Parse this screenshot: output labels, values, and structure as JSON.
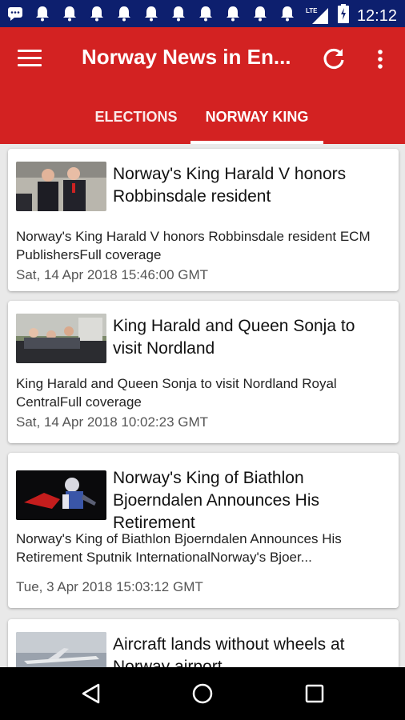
{
  "status_bar": {
    "time": "12:12",
    "network": "LTE",
    "icons_left": [
      "message-icon",
      "notification-bell-icon",
      "notification-bell-icon",
      "notification-bell-icon",
      "notification-bell-icon",
      "notification-bell-icon",
      "notification-bell-icon",
      "notification-bell-icon",
      "notification-bell-icon",
      "notification-bell-icon",
      "notification-bell-icon"
    ]
  },
  "app_bar": {
    "title": "Norway News in En...",
    "color": "#d32222",
    "tabs": [
      {
        "label": "ELECTIONS",
        "selected": false
      },
      {
        "label": "NORWAY KING",
        "selected": true
      }
    ]
  },
  "articles": [
    {
      "headline": "Norway's King Harald V honors Robbinsdale resident",
      "summary": "Norway's King Harald V honors Robbinsdale resident ECM PublishersFull coverage",
      "date": "Sat, 14 Apr 2018 15:46:00 GMT"
    },
    {
      "headline": "King Harald and Queen Sonja to visit Nordland",
      "summary": "King Harald and Queen Sonja to visit Nordland  Royal CentralFull coverage",
      "date": "Sat, 14 Apr 2018 10:02:23 GMT"
    },
    {
      "headline": "Norway's King of Biathlon Bjoerndalen Announces His Retirement",
      "summary": "Norway's King of Biathlon Bjoerndalen Announces His Retirement  Sputnik InternationalNorway's Bjoer...",
      "date": "Tue, 3 Apr 2018 15:03:12 GMT"
    },
    {
      "headline": "Aircraft lands without wheels at Norway airport",
      "summary": "",
      "date": ""
    }
  ],
  "nav_bar": {
    "buttons": [
      "back-icon",
      "home-icon",
      "recents-icon"
    ]
  }
}
